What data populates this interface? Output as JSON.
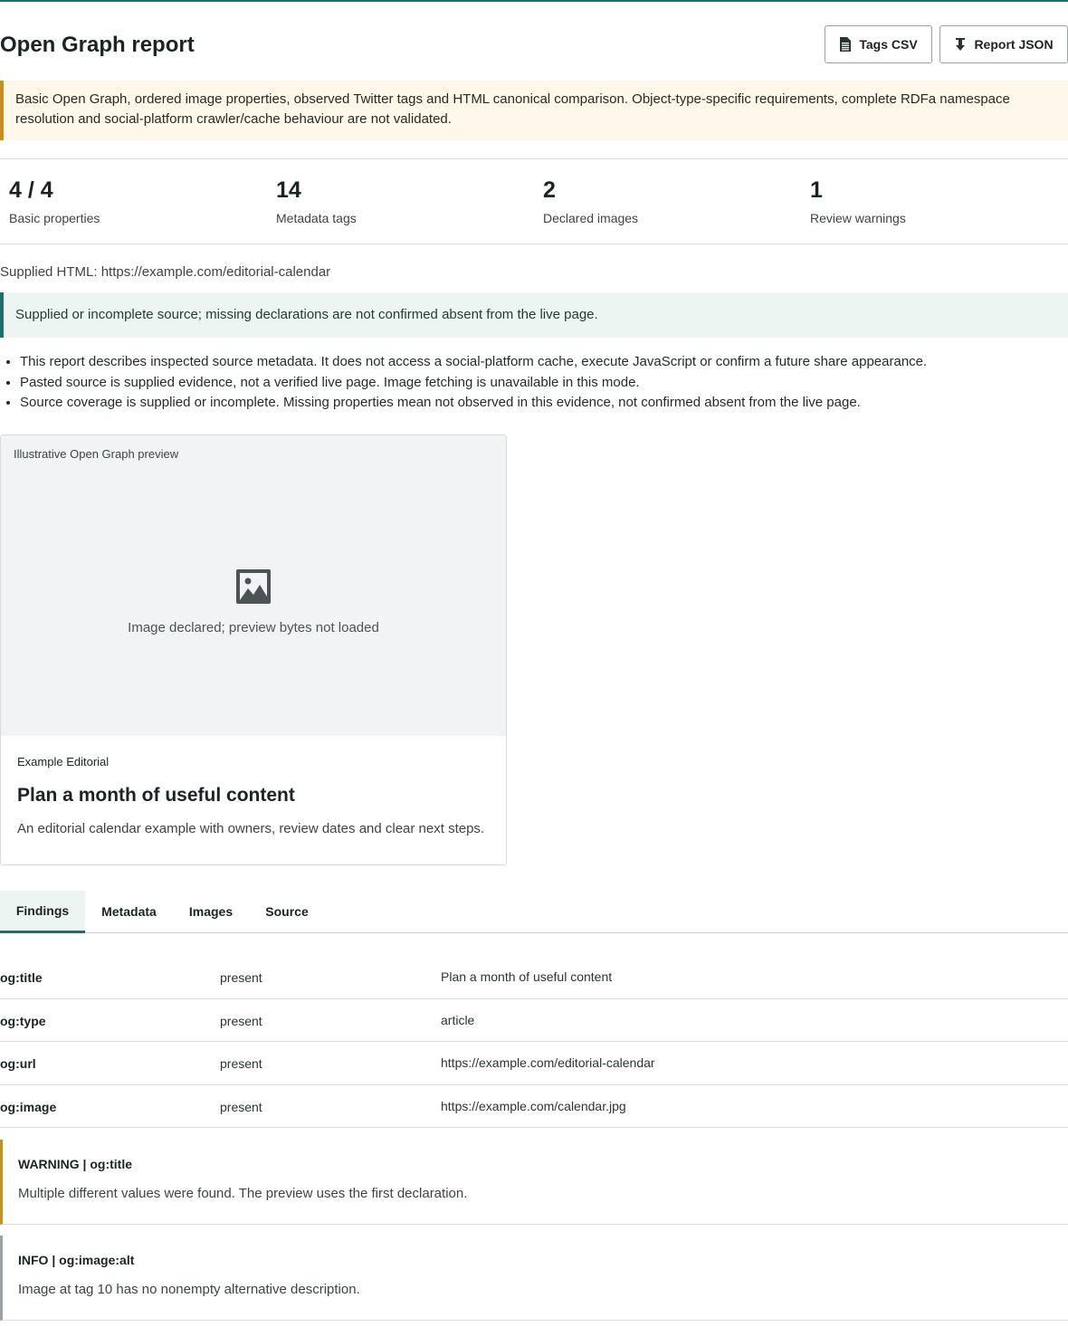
{
  "header": {
    "title": "Open Graph report",
    "tags_csv_label": "Tags CSV",
    "report_json_label": "Report JSON"
  },
  "scope_note": "Basic Open Graph, ordered image properties, observed Twitter tags and HTML canonical comparison. Object-type-specific requirements, complete RDFa namespace resolution and social-platform crawler/cache behaviour are not validated.",
  "stats": [
    {
      "value": "4 / 4",
      "label": "Basic properties"
    },
    {
      "value": "14",
      "label": "Metadata tags"
    },
    {
      "value": "2",
      "label": "Declared images"
    },
    {
      "value": "1",
      "label": "Review warnings"
    }
  ],
  "supplied_html": "Supplied HTML: https://example.com/editorial-calendar",
  "coverage_note": "Supplied or incomplete source; missing declarations are not confirmed absent from the live page.",
  "notes": [
    "This report describes inspected source metadata. It does not access a social-platform cache, execute JavaScript or confirm a future share appearance.",
    "Pasted source is supplied evidence, not a verified live page. Image fetching is unavailable in this mode.",
    "Source coverage is supplied or incomplete. Missing properties mean not observed in this evidence, not confirmed absent from the live page."
  ],
  "preview": {
    "caption": "Illustrative Open Graph preview",
    "placeholder": "Image declared; preview bytes not loaded",
    "site_name": "Example Editorial",
    "title": "Plan a month of useful content",
    "description": "An editorial calendar example with owners, review dates and clear next steps."
  },
  "tabs": [
    {
      "label": "Findings",
      "active": true
    },
    {
      "label": "Metadata",
      "active": false
    },
    {
      "label": "Images",
      "active": false
    },
    {
      "label": "Source",
      "active": false
    }
  ],
  "findings": [
    {
      "property": "og:title",
      "status": "present",
      "value": "Plan a month of useful content"
    },
    {
      "property": "og:type",
      "status": "present",
      "value": "article"
    },
    {
      "property": "og:url",
      "status": "present",
      "value": "https://example.com/editorial-calendar"
    },
    {
      "property": "og:image",
      "status": "present",
      "value": "https://example.com/calendar.jpg"
    }
  ],
  "issues": [
    {
      "heading": "WARNING | og:title",
      "message": "Multiple different values were found. The preview uses the first declaration."
    },
    {
      "heading": "INFO | og:image:alt",
      "message": "Image at tag 10 has no nonempty alternative description."
    }
  ],
  "colors": {
    "accent": "#1f6f68",
    "warning": "#c78f21",
    "warning_bg": "#fdf8ea",
    "info_bg": "#edf5f2"
  },
  "icons": [
    "document-icon",
    "download-icon",
    "image-icon"
  ]
}
